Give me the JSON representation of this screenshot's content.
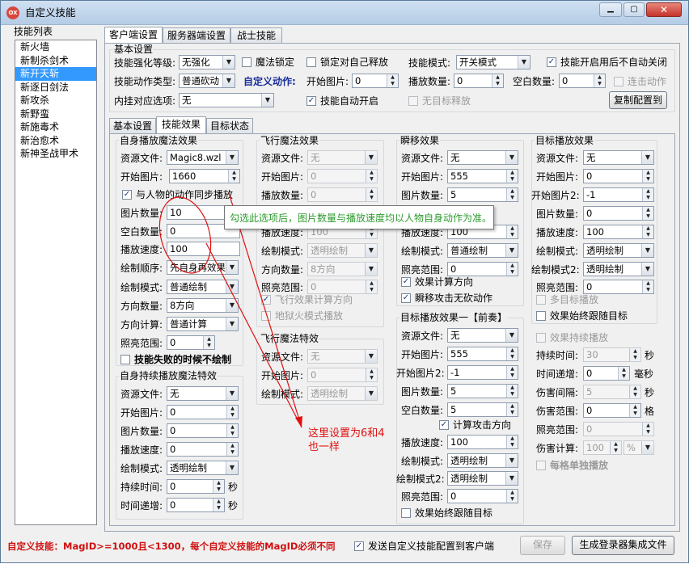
{
  "window": {
    "title": "自定义技能"
  },
  "sidebar": {
    "title": "技能列表",
    "items": [
      "新火墙",
      "新制杀剑术",
      "新开天斩",
      "新逐日剑法",
      "新攻杀",
      "新野蛮",
      "新施毒术",
      "新治愈术",
      "新神圣战甲术"
    ],
    "selected_index": 2
  },
  "top_tabs": [
    "客户端设置",
    "服务器端设置",
    "战士技能"
  ],
  "basic": {
    "title": "基本设置",
    "strength_label": "技能强化等级:",
    "strength_value": "无强化",
    "magic_lock": "魔法锁定",
    "lock_self": "锁定对自己释放",
    "mode_label": "技能模式:",
    "mode_value": "开关模式",
    "no_auto_close": "技能开启用后不自动关闭",
    "action_label": "技能动作类型:",
    "action_value": "普通砍动",
    "custom_action": "自定义动作:",
    "start_img_label": "开始图片:",
    "start_img_value": "0",
    "play_count_label": "播放数量:",
    "play_count_value": "0",
    "blank_count_label": "空白数量:",
    "blank_count_value": "0",
    "combo_action": "连击动作",
    "hook_label": "内挂对应选项:",
    "hook_value": "无",
    "auto_open": "技能自动开启",
    "no_target": "无目标释放",
    "copy_btn": "复制配置到"
  },
  "inner_tabs": [
    "基本设置",
    "技能效果",
    "目标状态"
  ],
  "self_play": {
    "title": "自身播放魔法效果",
    "res_label": "资源文件:",
    "res_value": "Magic8.wzl",
    "start_label": "开始图片:",
    "start_value": "1660",
    "sync_label": "与人物的动作同步播放",
    "img_count_label": "图片数量:",
    "img_count_value": "10",
    "blank_label": "空白数量:",
    "blank_value": "0",
    "speed_label": "播放速度:",
    "speed_value": "100",
    "order_label": "绘制顺序:",
    "order_value": "先自身再效果",
    "draw_label": "绘制模式:",
    "draw_value": "普通绘制",
    "dir_label": "方向数量:",
    "dir_value": "8方向",
    "calc_label": "方向计算:",
    "calc_value": "普通计算",
    "light_label": "照亮范围:",
    "light_value": "0",
    "fail_label": "技能失败的时候不绘制"
  },
  "self_cont": {
    "title": "自身持续播放魔法特效",
    "res_label": "资源文件:",
    "res_value": "无",
    "start_label": "开始图片:",
    "start_value": "0",
    "img_label": "图片数量:",
    "img_value": "0",
    "speed_label": "播放速度:",
    "speed_value": "0",
    "draw_label": "绘制模式:",
    "draw_value": "透明绘制",
    "dur_label": "持续时间:",
    "dur_value": "0",
    "dur_unit": "秒",
    "inc_label": "时间递增:",
    "inc_value": "0",
    "inc_unit": "秒"
  },
  "fly": {
    "title": "飞行魔法效果",
    "res_label": "资源文件:",
    "res_value": "无",
    "start_label": "开始图片:",
    "start_value": "0",
    "count_label": "播放数量:",
    "count_value": "0",
    "speed_label": "播放速度:",
    "speed_value": "100",
    "draw_label": "绘制模式:",
    "draw_value": "透明绘制",
    "dir_label": "方向数量:",
    "dir_value": "8方向",
    "light_label": "照亮范围:",
    "light_value": "0",
    "calc_dir": "飞行效果计算方向",
    "hell": "地狱火模式播放"
  },
  "fly_special": {
    "title": "飞行魔法特效",
    "res_label": "资源文件:",
    "res_value": "无",
    "start_label": "开始图片:",
    "start_value": "0",
    "draw_label": "绘制模式:",
    "draw_value": "透明绘制"
  },
  "blink": {
    "title": "瞬移效果",
    "res_label": "资源文件:",
    "res_value": "无",
    "start_label": "开始图片:",
    "start_value": "555",
    "img_label": "图片数量:",
    "img_value": "5",
    "speed_label": "播放速度:",
    "speed_value": "100",
    "draw_label": "绘制模式:",
    "draw_value": "普通绘制",
    "light_label": "照亮范围:",
    "light_value": "0",
    "calc_dir": "效果计算方向",
    "no_cut": "瞬移攻击无砍动作"
  },
  "target_pre": {
    "title": "目标播放效果一【前奏】",
    "res_label": "资源文件:",
    "res_value": "无",
    "start_label": "开始图片:",
    "start_value": "555",
    "start2_label": "开始图片2:",
    "start2_value": "-1",
    "img_label": "图片数量:",
    "img_value": "5",
    "blank_label": "空白数量:",
    "blank_value": "5",
    "calc_dir": "计算攻击方向",
    "speed_label": "播放速度:",
    "speed_value": "100",
    "draw_label": "绘制模式:",
    "draw_value": "透明绘制",
    "draw2_label": "绘制模式2:",
    "draw2_value": "透明绘制",
    "light_label": "照亮范围:",
    "light_value": "0",
    "follow": "效果始终跟随目标"
  },
  "target": {
    "title": "目标播放效果",
    "res_label": "资源文件:",
    "res_value": "无",
    "start_label": "开始图片:",
    "start_value": "0",
    "start2_label": "开始图片2:",
    "start2_value": "-1",
    "img_label": "图片数量:",
    "img_value": "0",
    "speed_label": "播放速度:",
    "speed_value": "100",
    "draw_label": "绘制模式:",
    "draw_value": "透明绘制",
    "draw2_label": "绘制模式2:",
    "draw2_value": "透明绘制",
    "light_label": "照亮范围:",
    "light_value": "0",
    "multi": "多目标播放",
    "follow": "效果始终跟随目标",
    "persist": "效果持续播放",
    "dur_label": "持续时间:",
    "dur_value": "30",
    "dur_unit": "秒",
    "inc_label": "时间递增:",
    "inc_value": "0",
    "inc_unit": "毫秒",
    "interval_label": "伤害间隔:",
    "interval_value": "5",
    "interval_unit": "秒",
    "range_label": "伤害范围:",
    "range_value": "0",
    "range_unit": "格",
    "light_label2": "照亮范围:",
    "light_value2": "0",
    "calc_label": "伤害计算:",
    "calc_value": "100",
    "calc_unit": "%",
    "each_cell": "每格单独播放"
  },
  "tooltip": "勾选此选项后，图片数量与播放速度均以人物自身动作为准。",
  "annotation": {
    "line1": "这里设置为6和4",
    "line2": "也一样"
  },
  "footer": {
    "note": "自定义技能：MagID>=1000且<1300，每个自定义技能的MagID必须不同",
    "send_config": "发送自定义技能配置到客户端",
    "save_btn": "保存",
    "gen_btn": "生成登录器集成文件"
  },
  "colors": {
    "title_bar": "#b9cfe8",
    "close_button": "#c9463d",
    "selected_item": "#3399ff",
    "annotation": "#e01010",
    "tooltip_text": "#2d9b2d",
    "note_red": "#d01010",
    "custom_action_blue": "#1a2f9a"
  }
}
